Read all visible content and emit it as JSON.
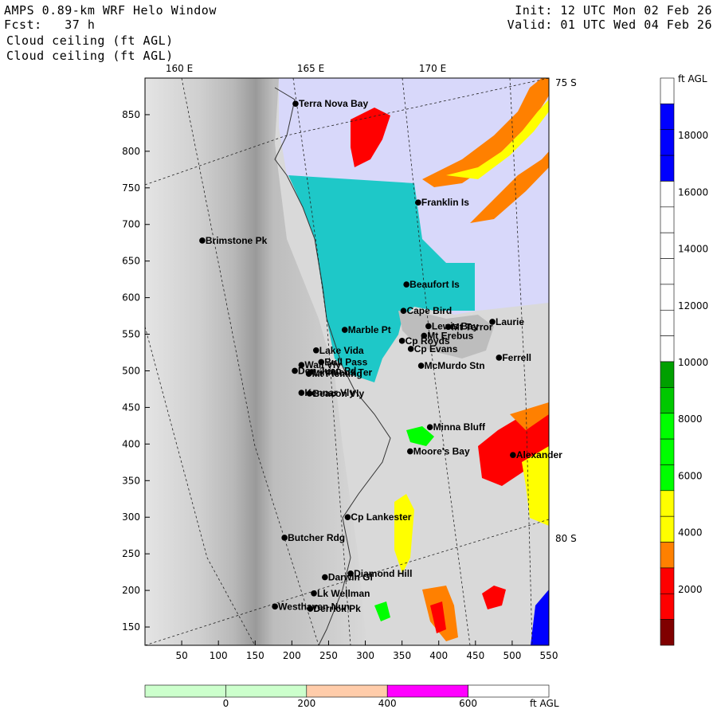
{
  "header": {
    "title": "AMPS 0.89-km WRF Helo Window",
    "fcst": "Fcst:   37 h",
    "field1": "Cloud ceiling (ft AGL)",
    "field2": "Cloud ceiling (ft AGL)",
    "init": "Init: 12 UTC Mon 02 Feb 26",
    "valid": "Valid: 01 UTC Wed 04 Feb 26"
  },
  "map": {
    "lon_labels": [
      "160 E",
      "165 E",
      "170 E"
    ],
    "lat_labels": [
      "75 S",
      "80 S"
    ],
    "x_ticks": [
      "50",
      "100",
      "150",
      "200",
      "250",
      "300",
      "350",
      "400",
      "450",
      "500",
      "550"
    ],
    "y_ticks": [
      "850",
      "800",
      "750",
      "700",
      "650",
      "600",
      "550",
      "500",
      "450",
      "400",
      "350",
      "300",
      "250",
      "200",
      "150"
    ],
    "x_range": [
      0,
      550
    ],
    "y_range": [
      125,
      900
    ],
    "places": [
      {
        "name": "Terra Nova Bay",
        "x": 205,
        "y": 865
      },
      {
        "name": "Franklin Is",
        "x": 372,
        "y": 730
      },
      {
        "name": "Brimstone Pk",
        "x": 78,
        "y": 678
      },
      {
        "name": "Beaufort Is",
        "x": 356,
        "y": 618
      },
      {
        "name": "Cape Bird",
        "x": 352,
        "y": 582
      },
      {
        "name": "Lewis Bay",
        "x": 386,
        "y": 561
      },
      {
        "name": "Laurie",
        "x": 473,
        "y": 567
      },
      {
        "name": "Mt Terror",
        "x": 413,
        "y": 560
      },
      {
        "name": "Marble Pt",
        "x": 272,
        "y": 556
      },
      {
        "name": "Cp Royds",
        "x": 350,
        "y": 541
      },
      {
        "name": "Mt Erebus",
        "x": 380,
        "y": 548
      },
      {
        "name": "Lake Vida",
        "x": 233,
        "y": 528
      },
      {
        "name": "Cp Evans",
        "x": 362,
        "y": 530
      },
      {
        "name": "Ferrell",
        "x": 482,
        "y": 518
      },
      {
        "name": "Wall Vly",
        "x": 213,
        "y": 508
      },
      {
        "name": "Bull Pass",
        "x": 240,
        "y": 512
      },
      {
        "name": "McMurdo Stn",
        "x": 376,
        "y": 507
      },
      {
        "name": "Don Juan Pd",
        "x": 204,
        "y": 500
      },
      {
        "name": "Mt Fleming",
        "x": 223,
        "y": 496
      },
      {
        "name": "Linnaeus Ter",
        "x": 225,
        "y": 498
      },
      {
        "name": "Kennar Vly",
        "x": 213,
        "y": 470
      },
      {
        "name": "Beacon Vly",
        "x": 224,
        "y": 469
      },
      {
        "name": "Minna Bluff",
        "x": 388,
        "y": 423
      },
      {
        "name": "Moore's Bay",
        "x": 361,
        "y": 390
      },
      {
        "name": "Alexander",
        "x": 501,
        "y": 385
      },
      {
        "name": "Cp Lankester",
        "x": 276,
        "y": 300
      },
      {
        "name": "Butcher Rdg",
        "x": 190,
        "y": 272
      },
      {
        "name": "Darwin Gl",
        "x": 245,
        "y": 218
      },
      {
        "name": "Diamond Hill",
        "x": 280,
        "y": 223
      },
      {
        "name": "Lk Wellman",
        "x": 230,
        "y": 196
      },
      {
        "name": "Westhaven Nun",
        "x": 177,
        "y": 178
      },
      {
        "name": "Derrick Pk",
        "x": 225,
        "y": 175
      }
    ]
  },
  "colorbar": {
    "unit": "ft AGL",
    "labels": [
      "18000",
      "16000",
      "14000",
      "12000",
      "10000",
      "8000",
      "6000",
      "4000",
      "2000"
    ],
    "colors": [
      "#ffffff",
      "#0000ff",
      "#0000ff",
      "#0000ff",
      "#ffffff",
      "#ffffff",
      "#ffffff",
      "#ffffff",
      "#ffffff",
      "#ffffff",
      "#ffffff",
      "#00a000",
      "#00c800",
      "#00ff00",
      "#00ff00",
      "#00ff00",
      "#ffff00",
      "#ffff00",
      "#ff8000",
      "#ff0000",
      "#ff0000",
      "#800000"
    ]
  },
  "terrain_bar": {
    "unit": "ft AGL",
    "labels": [
      "0",
      "200",
      "400",
      "600"
    ],
    "colors": [
      "#ccffcc",
      "#ccffcc",
      "#ffccaa",
      "#ff00ff",
      "#ffffff"
    ]
  }
}
